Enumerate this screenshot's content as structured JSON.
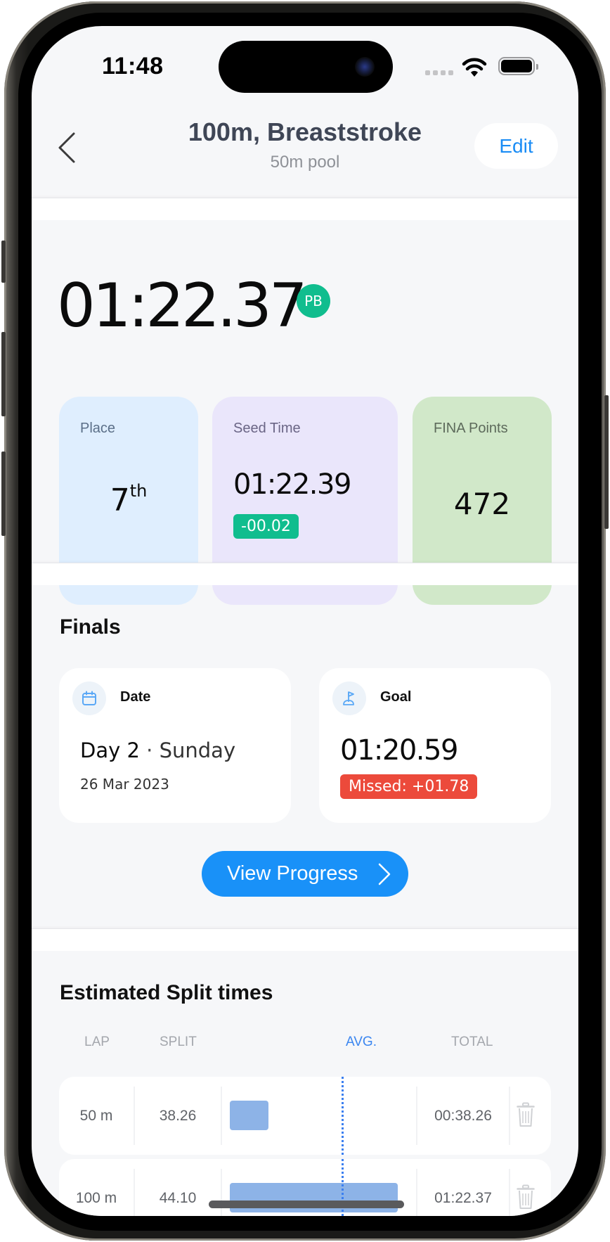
{
  "status_bar": {
    "time": "11:48"
  },
  "header": {
    "title": "100m, Breaststroke",
    "subtitle": "50m pool",
    "edit_label": "Edit"
  },
  "result": {
    "time": "01:22.37",
    "badge": "PB"
  },
  "stats": {
    "place": {
      "label": "Place",
      "value": "7",
      "suffix": "th"
    },
    "seed": {
      "label": "Seed Time",
      "value": "01:22.39",
      "diff": "-00.02"
    },
    "fina": {
      "label": "FINA Points",
      "value": "472"
    }
  },
  "finals": {
    "title": "Finals",
    "date_card": {
      "label": "Date",
      "day": "Day 2",
      "separator": "·",
      "weekday": "Sunday",
      "date": "26 Mar 2023"
    },
    "goal_card": {
      "label": "Goal",
      "value": "01:20.59",
      "status": "Missed: +01.78"
    },
    "view_progress_label": "View Progress"
  },
  "splits": {
    "title": "Estimated Split times",
    "columns": {
      "lap": "LAP",
      "split": "SPLIT",
      "avg": "AVG.",
      "total": "TOTAL"
    },
    "rows": [
      {
        "lap": "50 m",
        "split": "38.26",
        "total": "00:38.26",
        "bar_fraction": 0.19
      },
      {
        "lap": "100 m",
        "split": "44.10",
        "total": "01:22.37",
        "bar_fraction": 0.96
      }
    ],
    "avg_fraction": 0.59
  },
  "colors": {
    "accent": "#1991f8",
    "pb_green": "#10bd8e",
    "missed_red": "#ec4a3b",
    "avg_blue": "#3b86f0",
    "bar_blue": "#8db3e7"
  }
}
